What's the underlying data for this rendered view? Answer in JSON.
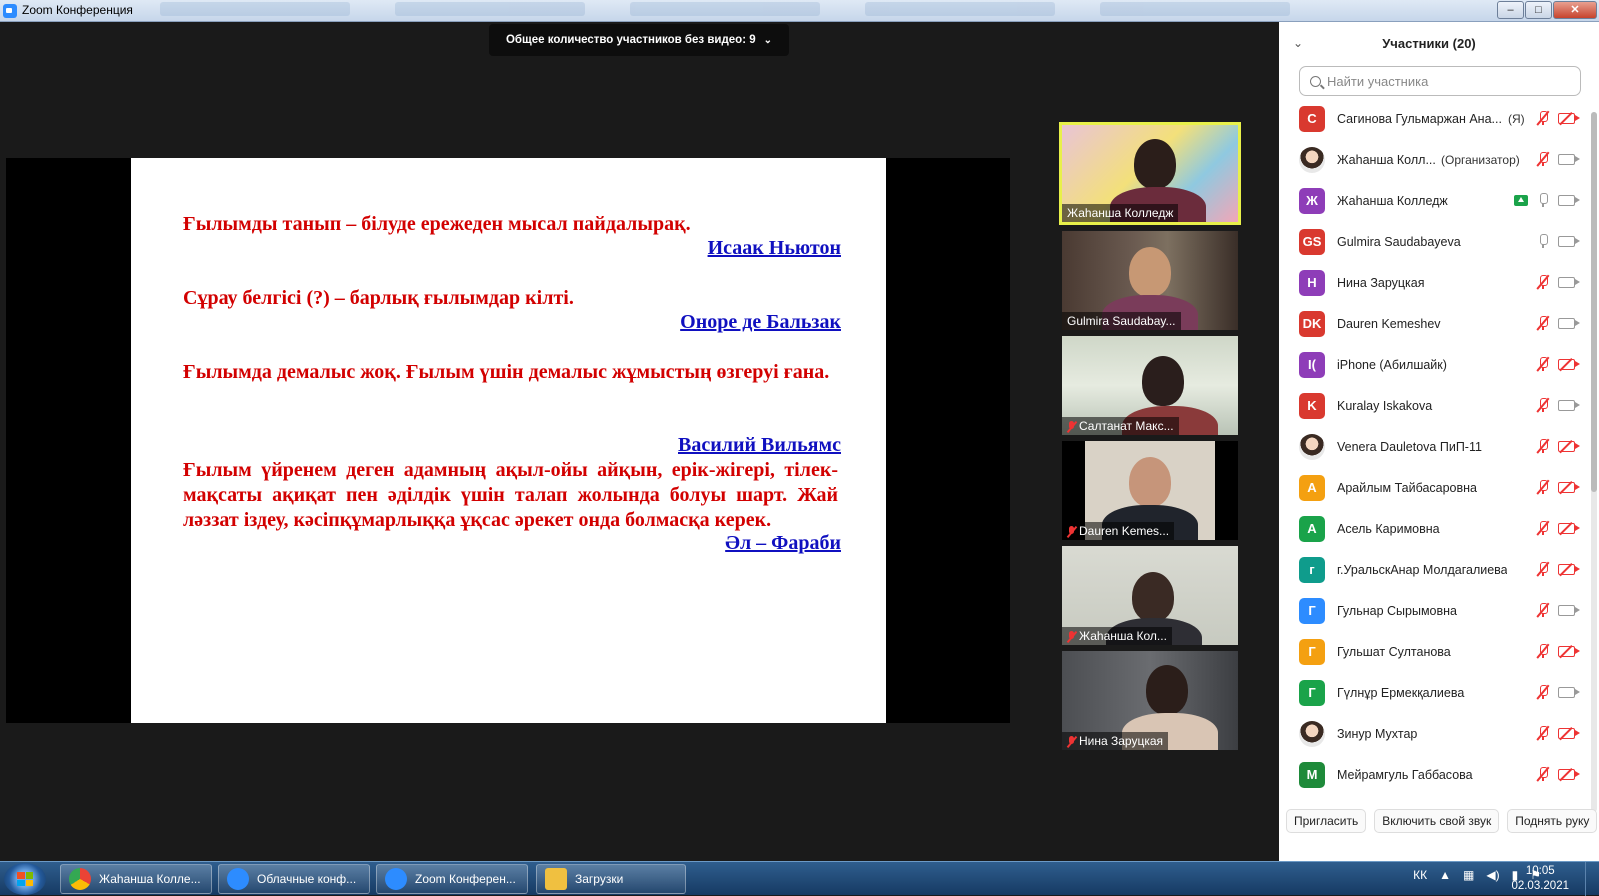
{
  "window": {
    "title": "Zoom Конференция"
  },
  "banner": {
    "text": "Общее количество участников без видео: 9"
  },
  "slide": {
    "q1": "Ғылымды танып – білуде ережеден мысал пайдалырақ.",
    "a1": "Исаак Ньютон",
    "q2": "Сұрау белгісі (?) – барлық ғылымдар кілті.",
    "a2": "Оноре де Бальзак",
    "q3": "Ғылымда демалыс жоқ. Ғылым үшін демалыс жұмыстың өзгеруі ғана.",
    "a3": "Василий Вильямс",
    "q4": "Ғылым үйренем деген адамның ақыл-ойы айқын, ерік-жігері, тілек-мақсаты ақиқат пен әділдік үшін талап жолында болуы шарт. Жай ләззат іздеу, кәсіпқұмарлыққа ұқсас әрекет онда болмасқа керек.",
    "a4": "Әл – Фараби"
  },
  "video_tiles": [
    {
      "name": "Жаһанша Колледж",
      "muted": false,
      "active": true
    },
    {
      "name": "Gulmira Saudabay...",
      "muted": false,
      "active": false
    },
    {
      "name": "Салтанат Макс...",
      "muted": true,
      "active": false
    },
    {
      "name": "Dauren Kemes...",
      "muted": true,
      "active": false
    },
    {
      "name": "Жаһанша Кол...",
      "muted": true,
      "active": false
    },
    {
      "name": "Нина Заруцкая",
      "muted": true,
      "active": false
    }
  ],
  "participants_panel": {
    "title": "Участники (20)",
    "search_placeholder": "Найти участника",
    "participants": [
      {
        "initials": "С",
        "color": "#d9392f",
        "name": "Сагинова Гульмаржан Ана...",
        "role": "(Я)",
        "mic": "off",
        "cam": "off"
      },
      {
        "initials": "",
        "color": "#ffffff",
        "name": "Жаһанша Колл...",
        "role": "(Организатор)",
        "mic": "off",
        "cam": "on",
        "photo": true
      },
      {
        "initials": "Ж",
        "color": "#8e3db8",
        "name": "Жаһанша Колледж",
        "role": "",
        "mic": "on",
        "cam": "on",
        "sharing": true
      },
      {
        "initials": "GS",
        "color": "#d9392f",
        "name": "Gulmira Saudabayeva",
        "role": "",
        "mic": "on",
        "cam": "on"
      },
      {
        "initials": "Н",
        "color": "#8e3db8",
        "name": " Нина Заруцкая",
        "role": "",
        "mic": "off",
        "cam": "on"
      },
      {
        "initials": "DK",
        "color": "#d9392f",
        "name": "Dauren Kemeshev",
        "role": "",
        "mic": "off",
        "cam": "on"
      },
      {
        "initials": "I(",
        "color": "#8e3db8",
        "name": "iPhone (Абилшайк)",
        "role": "",
        "mic": "off",
        "cam": "off"
      },
      {
        "initials": "K",
        "color": "#d9392f",
        "name": "Kuralay Iskakova",
        "role": "",
        "mic": "off",
        "cam": "on"
      },
      {
        "initials": "",
        "color": "#ffffff",
        "name": "Venera Dauletova ПиП-11",
        "role": "",
        "mic": "off",
        "cam": "off",
        "photo": true
      },
      {
        "initials": "А",
        "color": "#f4a011",
        "name": "Арайлым Тайбасаровна",
        "role": "",
        "mic": "off",
        "cam": "off"
      },
      {
        "initials": "А",
        "color": "#1aa34a",
        "name": "Асель Каримовна",
        "role": "",
        "mic": "off",
        "cam": "off"
      },
      {
        "initials": "г",
        "color": "#0f9c8c",
        "name": "г.УральскАнар Молдагалиева",
        "role": "",
        "mic": "off",
        "cam": "off"
      },
      {
        "initials": "Г",
        "color": "#2d8cff",
        "name": "Гульнар Сырымовна",
        "role": "",
        "mic": "off",
        "cam": "on"
      },
      {
        "initials": "Г",
        "color": "#f4a011",
        "name": "Гульшат Султанова",
        "role": "",
        "mic": "off",
        "cam": "off"
      },
      {
        "initials": "Г",
        "color": "#1aa34a",
        "name": "Гүлнұр Ермекқалиева",
        "role": "",
        "mic": "off",
        "cam": "on"
      },
      {
        "initials": "",
        "color": "#ffffff",
        "name": "Зинур Мухтар",
        "role": "",
        "mic": "off",
        "cam": "off",
        "photo": true
      },
      {
        "initials": "М",
        "color": "#1e8a3a",
        "name": "Мейрамгуль Габбасова",
        "role": "",
        "mic": "off",
        "cam": "off"
      }
    ],
    "buttons": {
      "invite": "Пригласить",
      "unmute": "Включить свой звук",
      "raise_hand": "Поднять руку"
    }
  },
  "taskbar": {
    "items": [
      {
        "label": "Жаһанша Колле...",
        "icon": "chrome-icon"
      },
      {
        "label": "Облачные конф...",
        "icon": "zoom-icon"
      },
      {
        "label": "Zoom Конферен...",
        "icon": "zoom-icon"
      },
      {
        "label": "Загрузки",
        "icon": "folder-icon"
      }
    ],
    "lang": "КК",
    "time": "10:05",
    "date": "02.03.2021"
  }
}
